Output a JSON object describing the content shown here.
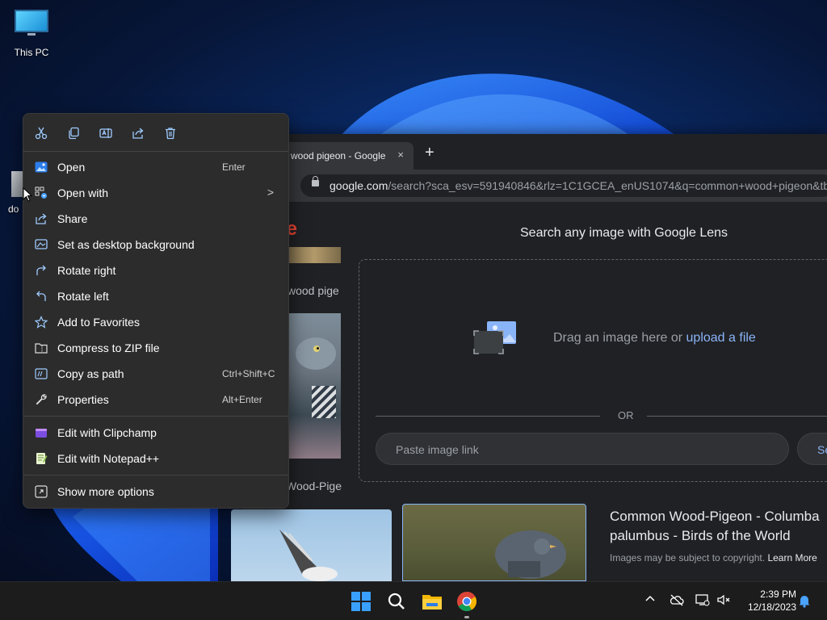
{
  "desktop": {
    "icons": [
      {
        "label": "This PC"
      },
      {
        "label": "do"
      }
    ]
  },
  "chrome": {
    "tab_title": "wood pigeon - Google",
    "tab_close": "×",
    "new_tab": "+",
    "url_host": "google.com",
    "url_rest": "/search?sca_esv=591940846&rlz=1C1GCEA_enUS1074&q=common+wood+pigeon&tb",
    "logo_partial": "le",
    "result_snippet_1": "wood pige",
    "result_snippet_2": "Wood-Pige",
    "lens": {
      "title": "Search any image with Google Lens",
      "drag_text": "Drag an image here or ",
      "upload_link": "upload a file",
      "or_text": "OR",
      "paste_placeholder": "Paste image link",
      "search_button": "Se"
    },
    "result_title": "Common Wood-Pigeon - Columba palumbus - Birds of the World",
    "copyright_note": "Images may be subject to copyright.",
    "learn_more": "Learn More"
  },
  "context_menu": {
    "quick_actions": [
      "cut",
      "copy",
      "rename",
      "share",
      "delete"
    ],
    "items": [
      {
        "label": "Open",
        "shortcut": "Enter"
      },
      {
        "label": "Open with",
        "shortcut": ""
      },
      {
        "label": "Share",
        "shortcut": ""
      },
      {
        "label": "Set as desktop background",
        "shortcut": ""
      },
      {
        "label": "Rotate right",
        "shortcut": ""
      },
      {
        "label": "Rotate left",
        "shortcut": ""
      },
      {
        "label": "Add to Favorites",
        "shortcut": ""
      },
      {
        "label": "Compress to ZIP file",
        "shortcut": ""
      },
      {
        "label": "Copy as path",
        "shortcut": "Ctrl+Shift+C"
      },
      {
        "label": "Properties",
        "shortcut": "Alt+Enter"
      },
      {
        "label": "Edit with Clipchamp",
        "shortcut": ""
      },
      {
        "label": "Edit with Notepad++",
        "shortcut": ""
      },
      {
        "label": "Show more options",
        "shortcut": ""
      }
    ],
    "submenu_arrow": ">"
  },
  "taskbar": {
    "time": "2:39 PM",
    "date": "12/18/2023",
    "tray_chevron": "^"
  }
}
